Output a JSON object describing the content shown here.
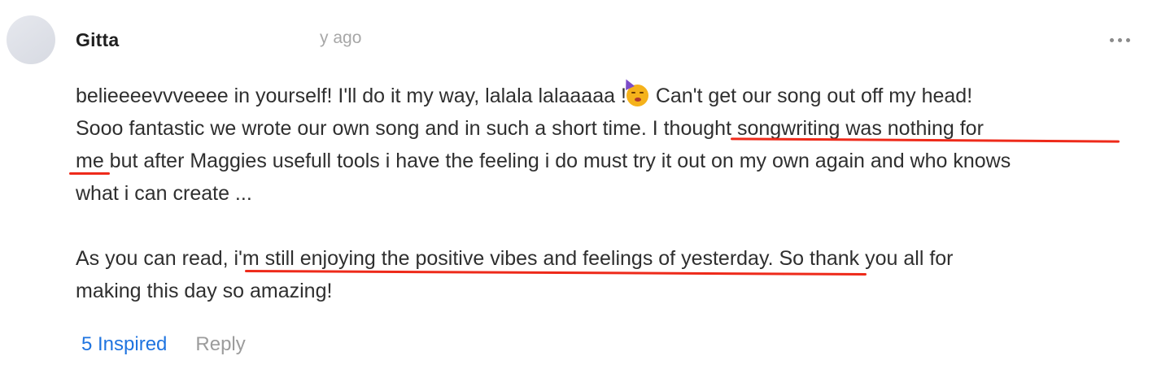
{
  "comment": {
    "author": "Gitta",
    "timestamp": "y ago",
    "menu_icon": "more-horizontal-icon",
    "emoji_icon": "partying-face-icon",
    "lines": {
      "l1_before_emoji": "belieeeevvveeee in yourself! I'll do it my way, lalala lalaaaaa !",
      "l1_after_emoji": " Can't get our song out off my head!",
      "l2": "Sooo fantastic we wrote our own song and in such a short time. I thought songwriting was nothing for",
      "l3": "me but after Maggies usefull tools i have the feeling i do must try it out on my own again and who knows",
      "l4": "what i can create ...",
      "l5": "As you can read, i'm still enjoying the positive vibes and feelings of yesterday. So thank you all for",
      "l6": "making this day so amazing!"
    }
  },
  "actions": {
    "inspired_label": "5 Inspired",
    "reply_label": "Reply"
  },
  "colors": {
    "annotation_underline": "#ee2a1a",
    "link_blue": "#1f74e0",
    "muted_gray": "#9c9c9c"
  }
}
